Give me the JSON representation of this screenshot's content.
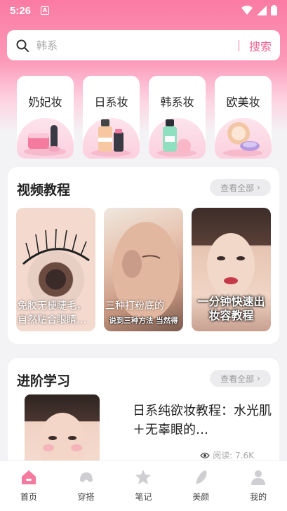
{
  "status_bar": {
    "time": "5:26",
    "badge": "A"
  },
  "search": {
    "placeholder": "韩系",
    "button_label": "搜索"
  },
  "categories": [
    {
      "label": "奶妃妆",
      "icon": "lotion-icon"
    },
    {
      "label": "日系妆",
      "icon": "foundation-bottle-icon"
    },
    {
      "label": "韩系妆",
      "icon": "toner-bottle-icon"
    },
    {
      "label": "欧美妆",
      "icon": "compact-powder-icon"
    }
  ],
  "video_section": {
    "title": "视频教程",
    "view_all": "查看全部",
    "videos": [
      {
        "caption": "免胶无梗睫毛，自然贴合眼睛…"
      },
      {
        "caption": "三种打粉底的",
        "subtitle": "说到三种方法 当然得"
      },
      {
        "caption": "一分钟快速出妆容教程"
      }
    ]
  },
  "advanced_section": {
    "title": "进阶学习",
    "view_all": "查看全部",
    "article": {
      "title": "日系纯欲妆教程：水光肌＋无辜眼的…",
      "reads": "阅读: 7.6K"
    }
  },
  "bottom_nav": [
    {
      "label": "首页",
      "icon": "home-icon",
      "active": true
    },
    {
      "label": "穿搭",
      "icon": "outfit-icon",
      "active": false
    },
    {
      "label": "笔记",
      "icon": "note-icon",
      "active": false
    },
    {
      "label": "美颜",
      "icon": "beauty-icon",
      "active": false
    },
    {
      "label": "我的",
      "icon": "profile-icon",
      "active": false
    }
  ],
  "colors": {
    "accent": "#f06292",
    "header_pink": "#fa7ba4",
    "background": "#f3f3f5"
  }
}
